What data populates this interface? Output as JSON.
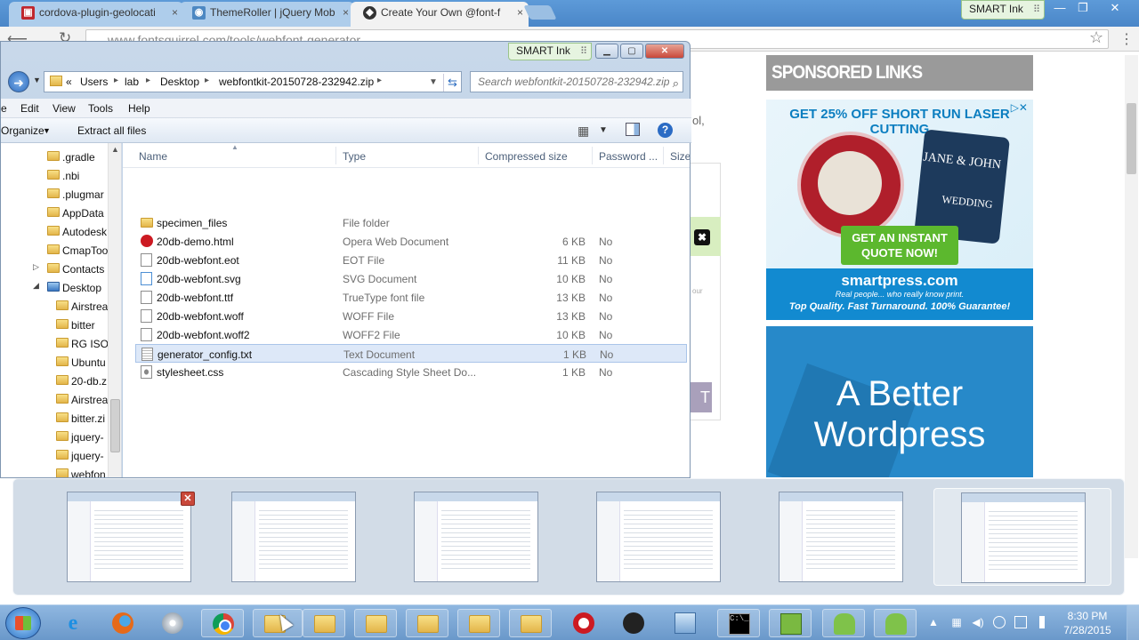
{
  "browser": {
    "tabs": [
      {
        "title": "cordova-plugin-geolocati",
        "close": "×"
      },
      {
        "title": "ThemeRoller | jQuery Mob",
        "close": "×"
      },
      {
        "title": "Create Your Own @font-f",
        "close": "×"
      }
    ],
    "smart_ink": "SMART Ink",
    "window_controls": {
      "minimize": "—",
      "maximize": "❐",
      "close": "✕"
    },
    "url": "www.fontsquirrel.com/tools/webfont-generator",
    "page": {
      "fragment_text": "ol,",
      "fragment_small": "our",
      "fragment_button": "T",
      "close_glyph": "✖"
    },
    "sponsored": {
      "title": "SPONSORED LINKS"
    },
    "ad_laser": {
      "headline": "GET 25% OFF SHORT RUN LASER CUTTING",
      "close_glyph": "▷✕",
      "card_names": "JANE & JOHN",
      "card_sub": "WEDDING",
      "cta": "GET AN INSTANT QUOTE NOW!",
      "domain": "smartpress.com",
      "sub": "Real people... who really know print.",
      "tagline": "Top Quality. Fast Turnaround. 100% Guarantee!"
    },
    "ad_wordpress": {
      "line1": "A Better",
      "line2": "Wordpress"
    }
  },
  "explorer": {
    "smart_ink": "SMART Ink",
    "controls": {
      "minimize": "▁",
      "maximize": "▢",
      "close": "✕"
    },
    "breadcrumbs": [
      "«",
      "Users",
      "lab",
      "Desktop",
      "webfontkit-20150728-232942.zip"
    ],
    "search_placeholder": "Search webfontkit-20150728-232942.zip",
    "menu": [
      "e",
      "Edit",
      "View",
      "Tools",
      "Help"
    ],
    "commands": {
      "organize": "Organize",
      "organize_arrow": "▼",
      "extract": "Extract all files",
      "view_arrow": "▼",
      "help": "?"
    },
    "nav_items": [
      ".gradle",
      ".nbi",
      ".plugmar",
      "AppData",
      "Autodesk",
      "CmapToo",
      "Contacts",
      "Desktop",
      "Airstrea",
      "bitter",
      "RG ISOs",
      "Ubuntu",
      "20-db.z",
      "Airstrea",
      "bitter.zi",
      "jquery-",
      "jquery-",
      "webfon"
    ],
    "columns": [
      "Name",
      "Type",
      "Compressed size",
      "Password ...",
      "Size"
    ],
    "files": [
      {
        "name": "specimen_files",
        "type": "File folder",
        "size": "",
        "password": "",
        "icon": "folder-icon"
      },
      {
        "name": "20db-demo.html",
        "type": "Opera Web Document",
        "size": "6 KB",
        "password": "No",
        "icon": "opera-icon"
      },
      {
        "name": "20db-webfont.eot",
        "type": "EOT File",
        "size": "11 KB",
        "password": "No",
        "icon": "file-icon"
      },
      {
        "name": "20db-webfont.svg",
        "type": "SVG Document",
        "size": "10 KB",
        "password": "No",
        "icon": "svg-file-icon"
      },
      {
        "name": "20db-webfont.ttf",
        "type": "TrueType font file",
        "size": "13 KB",
        "password": "No",
        "icon": "file-icon"
      },
      {
        "name": "20db-webfont.woff",
        "type": "WOFF File",
        "size": "13 KB",
        "password": "No",
        "icon": "file-icon"
      },
      {
        "name": "20db-webfont.woff2",
        "type": "WOFF2 File",
        "size": "10 KB",
        "password": "No",
        "icon": "file-icon"
      },
      {
        "name": "generator_config.txt",
        "type": "Text Document",
        "size": "1 KB",
        "password": "No",
        "icon": "text-file-icon"
      },
      {
        "name": "stylesheet.css",
        "type": "Cascading Style Sheet Do...",
        "size": "1 KB",
        "password": "No",
        "icon": "css-file-icon"
      }
    ]
  },
  "thumbnails": {
    "close": "✕"
  },
  "taskbar": {
    "ie_glyph": "e",
    "cmd_glyph": "C:\\_",
    "clock_time": "8:30 PM",
    "clock_date": "7/28/2015",
    "tray": {
      "arrow": "▲",
      "speaker": "◀)",
      "network": "▦"
    }
  }
}
